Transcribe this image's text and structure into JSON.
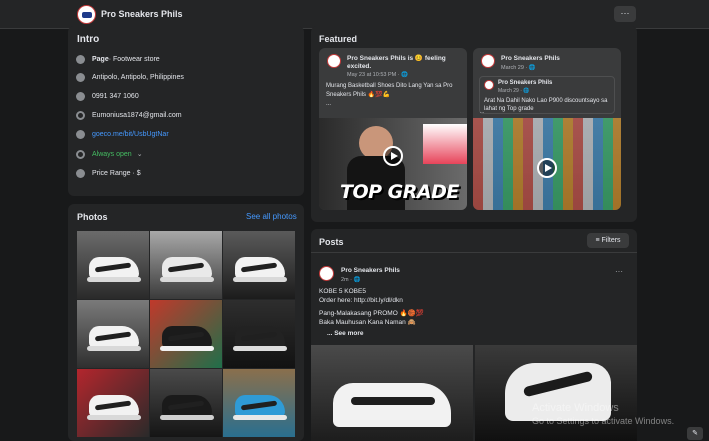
{
  "header": {
    "page_name": "Pro Sneakers Phils",
    "more_label": "···"
  },
  "intro": {
    "title": "Intro",
    "page_prefix": "Page",
    "page_category": " · Footwear store",
    "location": "Antipolo, Antipolo, Philippines",
    "phone": "0991 347 1060",
    "email": "Eumoniusa1874@gmail.com",
    "link": "goeco.me/bit/UsbUgtNar",
    "hours": "Always open",
    "hours_chevron": "⌄",
    "price": "Price Range · $"
  },
  "photos": {
    "title": "Photos",
    "see_all": "See all photos"
  },
  "featured": {
    "title": "Featured",
    "cards": [
      {
        "name": "Pro Sneakers Phils is 😊 feeling excited.",
        "time": "May 23 at 10:53 PM · 🌐",
        "text": "Murang Basketball Shoes Dito Lang Yan sa Pro Sneakers Phils 🔥💯💪",
        "more": "...",
        "overlay": "TOP GRADE"
      },
      {
        "name": "Pro Sneakers Phils",
        "time": "March 29 · 🌐",
        "inner_name": "Pro Sneakers Phils",
        "inner_time": "March 29 · 🌐",
        "text": "Arat Na Dahil Nako Lao P900 discountsayo sa lahat ng Top grade",
        "more": "..."
      }
    ]
  },
  "posts": {
    "title": "Posts",
    "filters_label": "Filters",
    "post": {
      "name": "Pro Sneakers Phils",
      "time": "2m · 🌐",
      "more": "···",
      "line1": "KOBE 5 KOBE5",
      "line2": "Order here: http://bit.ly/dl/dkn",
      "line3": "Pang-Malakasang PROMO 🔥🏀💯",
      "line4": "Baka Mauhusan Kana Naman 🙈",
      "see_more": "... See more"
    }
  },
  "watermark": {
    "line1": "Activate Windows",
    "line2": "Go to Settings to activate Windows."
  },
  "corner_icon": "edit-icon"
}
